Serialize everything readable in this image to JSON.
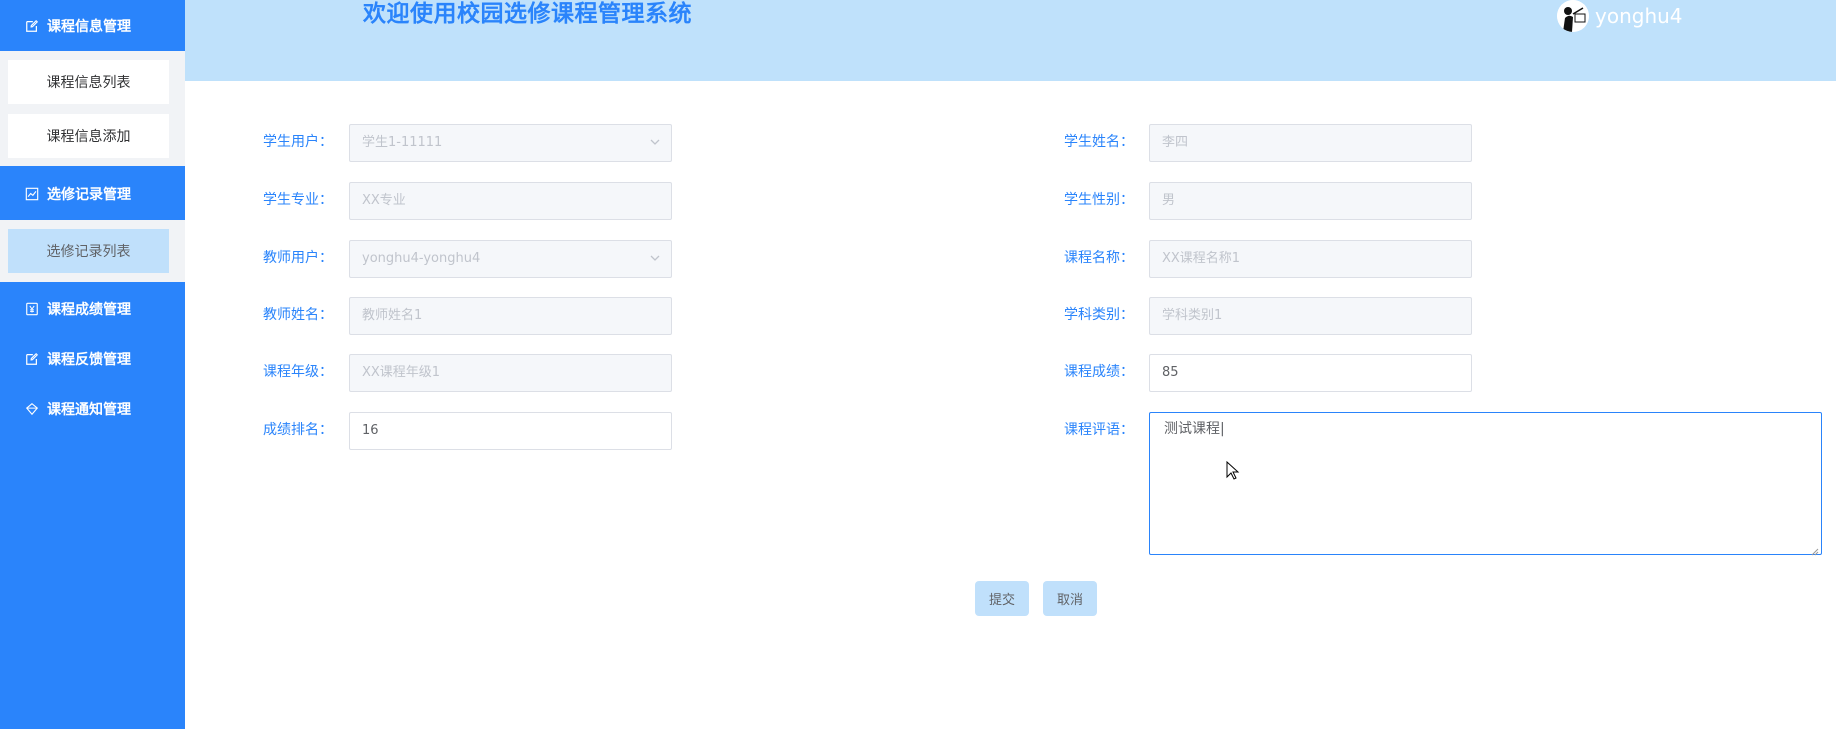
{
  "header": {
    "title": "欢迎使用校园选修课程管理系统",
    "username": "yonghu4",
    "colors": {
      "bar": "#bfe1fb",
      "title": "#2a84fb"
    }
  },
  "sidebar": {
    "color": "#2a84fb",
    "groups": [
      {
        "label": "课程信息管理",
        "icon": "edit-icon",
        "items": [
          "课程信息列表",
          "课程信息添加"
        ]
      },
      {
        "label": "选修记录管理",
        "icon": "chart-line-icon",
        "items": [
          "选修记录列表"
        ],
        "active_item": "选修记录列表"
      },
      {
        "label": "课程成绩管理",
        "icon": "yen-icon",
        "items": []
      },
      {
        "label": "课程反馈管理",
        "icon": "edit-icon",
        "items": []
      },
      {
        "label": "课程通知管理",
        "icon": "diamond-icon",
        "items": []
      }
    ]
  },
  "form": {
    "student_user": {
      "label": "学生用户：",
      "value": "学生1-11111"
    },
    "student_name": {
      "label": "学生姓名：",
      "value": "李四"
    },
    "student_major": {
      "label": "学生专业：",
      "value": "XX专业"
    },
    "student_gender": {
      "label": "学生性别：",
      "value": "男"
    },
    "teacher_user": {
      "label": "教师用户：",
      "value": "yonghu4-yonghu4"
    },
    "course_name": {
      "label": "课程名称：",
      "value": "XX课程名称1"
    },
    "teacher_name": {
      "label": "教师姓名：",
      "value": "教师姓名1"
    },
    "subject_category": {
      "label": "学科类别：",
      "value": "学科类别1"
    },
    "course_grade_level": {
      "label": "课程年级：",
      "value": "XX课程年级1"
    },
    "course_score": {
      "label": "课程成绩：",
      "value": "85"
    },
    "score_rank": {
      "label": "成绩排名：",
      "value": "16"
    },
    "course_comment": {
      "label": "课程评语：",
      "value": "测试课程|"
    }
  },
  "buttons": {
    "submit": "提交",
    "cancel": "取消"
  }
}
